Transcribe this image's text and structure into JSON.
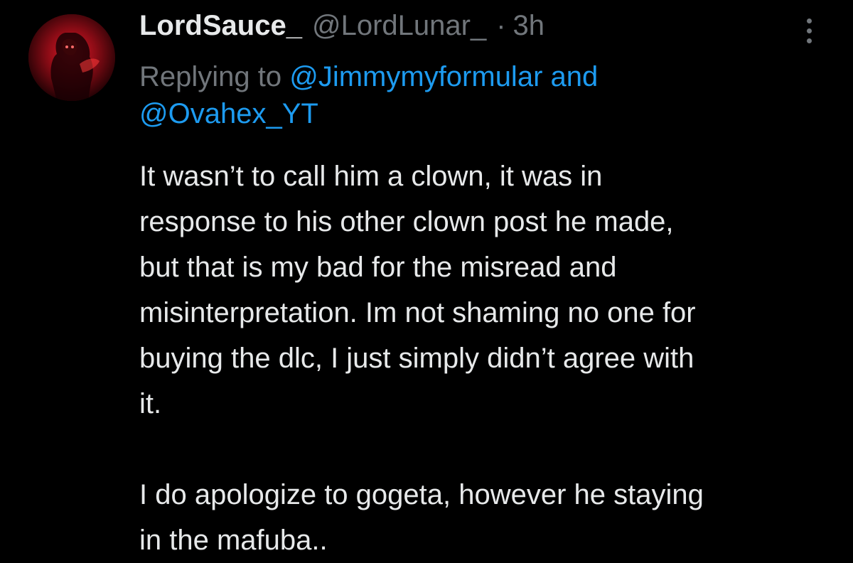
{
  "author": {
    "display_name": "LordSauce_",
    "handle": "@LordLunar_",
    "separator": "·",
    "time": "3h"
  },
  "reply": {
    "prefix": "Replying to ",
    "mention_1": "@Jimmymyformular",
    "conjunction": " and",
    "mention_2": "@Ovahex_YT"
  },
  "body": {
    "line_1": "It wasn’t to call him a clown, it was in",
    "line_2": "response to his other clown post he made,",
    "line_3": "but that is my bad for the misread and",
    "line_4": "misinterpretation. Im not shaming no one for",
    "line_5": "buying the dlc, I just simply didn’t agree with",
    "line_6": "it.",
    "line_7": "I do apologize to gogeta, however he staying",
    "line_8": "in the mafuba.."
  },
  "icons": {
    "more": "more-vertical-icon",
    "avatar": "avatar"
  },
  "colors": {
    "background": "#000000",
    "text_primary": "#e7e9ea",
    "text_secondary": "#71767b",
    "link": "#1d9bf0",
    "avatar_accent": "#c1121f"
  }
}
